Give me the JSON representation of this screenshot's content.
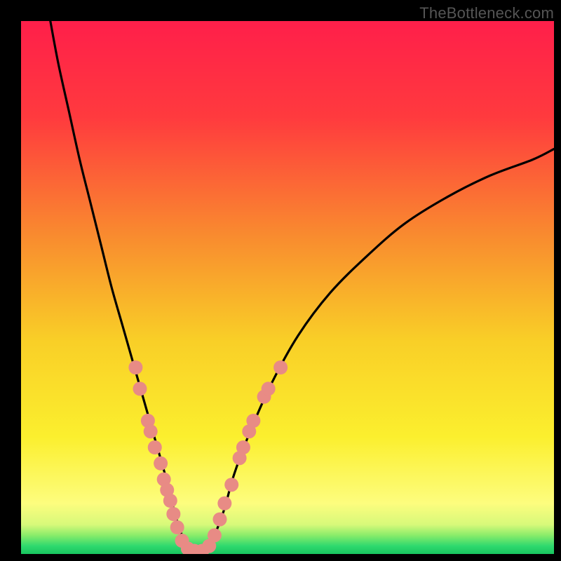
{
  "watermark": "TheBottleneck.com",
  "chart_data": {
    "type": "line",
    "title": "",
    "xlabel": "",
    "ylabel": "",
    "xlim": [
      0,
      100
    ],
    "ylim": [
      0,
      100
    ],
    "gradient_stops": [
      {
        "offset": 0,
        "color": "#ff1f4a"
      },
      {
        "offset": 0.18,
        "color": "#ff3a3e"
      },
      {
        "offset": 0.4,
        "color": "#f98a2f"
      },
      {
        "offset": 0.6,
        "color": "#f9cf27"
      },
      {
        "offset": 0.78,
        "color": "#fbef2e"
      },
      {
        "offset": 0.905,
        "color": "#fdfd7e"
      },
      {
        "offset": 0.945,
        "color": "#d7f97a"
      },
      {
        "offset": 0.965,
        "color": "#89ec6a"
      },
      {
        "offset": 0.985,
        "color": "#2fd96e"
      },
      {
        "offset": 1.0,
        "color": "#18c55f"
      }
    ],
    "series": [
      {
        "name": "bottleneck-curve",
        "x": [
          5.5,
          7,
          9,
          11,
          13,
          15,
          17,
          19,
          21,
          23,
          25,
          27,
          28.5,
          30,
          32,
          34,
          36,
          38,
          40,
          43,
          47,
          52,
          58,
          65,
          72,
          80,
          88,
          96,
          100
        ],
        "y": [
          100,
          92,
          83,
          74,
          66,
          58,
          50,
          43,
          36,
          29,
          22,
          15,
          9,
          4,
          0.5,
          0.5,
          3,
          8,
          15,
          23,
          32,
          41,
          49,
          56,
          62,
          67,
          71,
          74,
          76
        ]
      }
    ],
    "markers": {
      "color": "#e88b85",
      "radius_px": 10,
      "points": [
        {
          "x": 21.5,
          "y": 35
        },
        {
          "x": 22.3,
          "y": 31
        },
        {
          "x": 23.8,
          "y": 25
        },
        {
          "x": 24.3,
          "y": 23
        },
        {
          "x": 25.1,
          "y": 20
        },
        {
          "x": 26.2,
          "y": 17
        },
        {
          "x": 26.8,
          "y": 14
        },
        {
          "x": 27.4,
          "y": 12
        },
        {
          "x": 28.0,
          "y": 10
        },
        {
          "x": 28.6,
          "y": 7.5
        },
        {
          "x": 29.3,
          "y": 5
        },
        {
          "x": 30.2,
          "y": 2.5
        },
        {
          "x": 31.3,
          "y": 1.0
        },
        {
          "x": 32.5,
          "y": 0.6
        },
        {
          "x": 34.0,
          "y": 0.6
        },
        {
          "x": 35.3,
          "y": 1.5
        },
        {
          "x": 36.3,
          "y": 3.5
        },
        {
          "x": 37.3,
          "y": 6.5
        },
        {
          "x": 38.2,
          "y": 9.5
        },
        {
          "x": 39.5,
          "y": 13
        },
        {
          "x": 41.0,
          "y": 18
        },
        {
          "x": 41.7,
          "y": 20
        },
        {
          "x": 42.8,
          "y": 23
        },
        {
          "x": 43.6,
          "y": 25
        },
        {
          "x": 45.6,
          "y": 29.5
        },
        {
          "x": 46.4,
          "y": 31
        },
        {
          "x": 48.7,
          "y": 35
        }
      ]
    }
  }
}
